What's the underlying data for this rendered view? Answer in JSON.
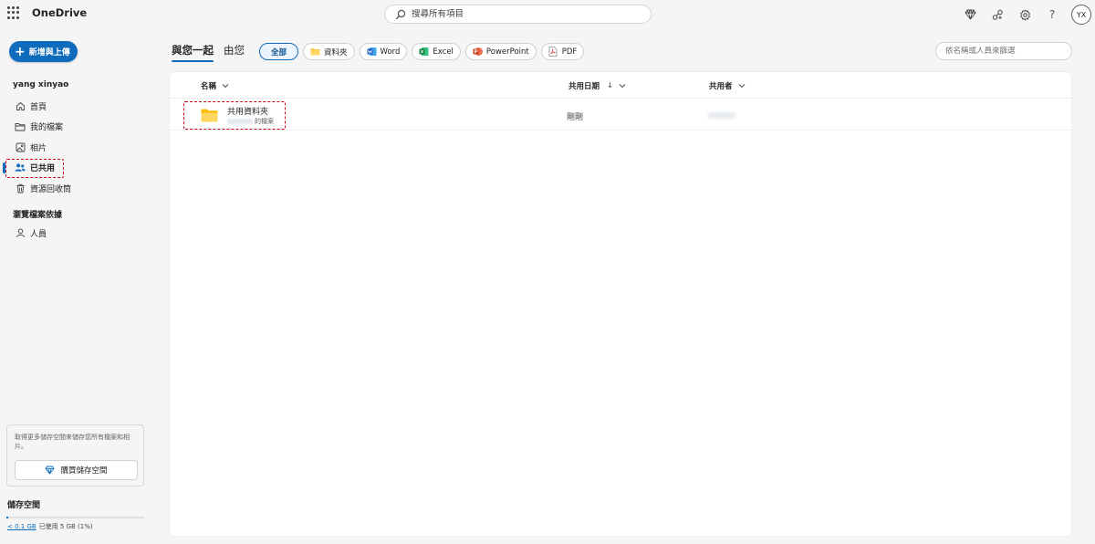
{
  "header": {
    "app_name": "OneDrive",
    "search_placeholder": "搜尋所有項目",
    "help_label": "?",
    "avatar_initials": "YX"
  },
  "sidebar": {
    "new_button": "新增與上傳",
    "user_name": "yang xinyao",
    "items": [
      {
        "label": "首頁",
        "icon": "home-icon"
      },
      {
        "label": "我的檔案",
        "icon": "folder-icon"
      },
      {
        "label": "相片",
        "icon": "image-icon"
      },
      {
        "label": "已共用",
        "icon": "people-icon",
        "active": true
      },
      {
        "label": "資源回收筒",
        "icon": "trash-icon"
      }
    ],
    "browse_heading": "瀏覽檔案依據",
    "browse_items": [
      {
        "label": "人員",
        "icon": "person-icon"
      }
    ],
    "promo_text": "取得更多儲存空間來儲存您所有檔案和相片。",
    "promo_button": "購買儲存空間",
    "storage_title": "儲存空間",
    "storage_used_link": "< 0.1 GB",
    "storage_used_text": "已使用 5 GB (1%)",
    "storage_fraction": 0.01
  },
  "main": {
    "tabs": [
      {
        "label": "與您一起",
        "active": true
      },
      {
        "label": "由您",
        "active": false
      }
    ],
    "filters": [
      {
        "label": "全部",
        "selected": true
      },
      {
        "label": "資料夾",
        "icon": "folder-icon"
      },
      {
        "label": "Word",
        "icon": "word-icon"
      },
      {
        "label": "Excel",
        "icon": "excel-icon"
      },
      {
        "label": "PowerPoint",
        "icon": "powerpoint-icon"
      },
      {
        "label": "PDF",
        "icon": "pdf-icon"
      }
    ],
    "filter_placeholder": "依名稱或人員來篩選",
    "columns": {
      "name": "名稱",
      "shared_date": "共用日期",
      "sort_arrow": "↓",
      "shared_by": "共用者"
    },
    "rows": [
      {
        "name": "共用資料夾",
        "subtitle": "的檔案",
        "date": "剛剛"
      }
    ]
  },
  "colors": {
    "accent": "#0f6cbd",
    "highlight": "#d0021b",
    "folder": "#ffc83d"
  }
}
